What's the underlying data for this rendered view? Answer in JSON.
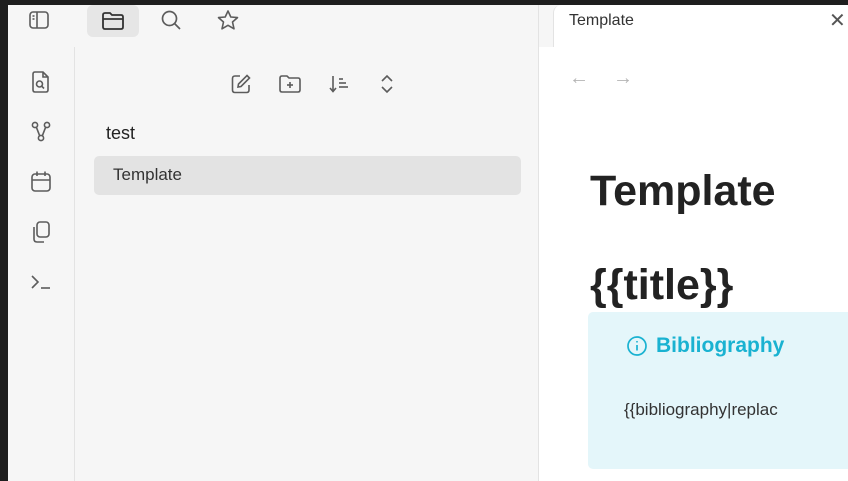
{
  "top_bar": {
    "icons": [
      "sidebar-toggle-icon",
      "folder-icon",
      "search-icon",
      "star-icon"
    ],
    "active": "folder-icon"
  },
  "ribbon": {
    "icons": [
      "file-search-icon",
      "graph-icon",
      "calendar-icon",
      "copy-icon",
      "terminal-icon"
    ]
  },
  "explorer": {
    "toolbar_icons": [
      "new-note-icon",
      "new-folder-icon",
      "sort-icon",
      "collapse-icon"
    ],
    "folder_name": "test",
    "files": [
      {
        "name": "Template",
        "selected": true
      }
    ]
  },
  "tab": {
    "title": "Template",
    "close": "✕"
  },
  "nav": {
    "back": "←",
    "forward": "→"
  },
  "document": {
    "title": "Template",
    "heading": "{{title}}",
    "callout": {
      "type": "info",
      "title": "Bibliography",
      "body": "{{bibliography|replac"
    }
  },
  "colors": {
    "accent": "#19b2d1",
    "callout_bg": "#e4f6fa",
    "selected_bg": "#e3e3e3",
    "panel_bg": "#f6f6f6"
  }
}
